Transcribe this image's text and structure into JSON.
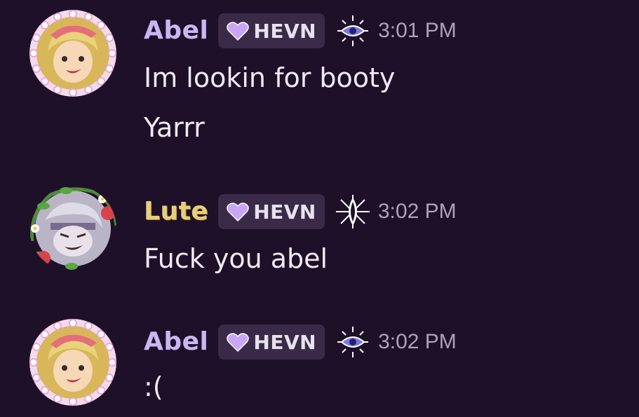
{
  "messages": [
    {
      "author": "Abel",
      "tag": "HEVN",
      "badge_icon": "eye-sun-icon",
      "time": "3:01 PM",
      "lines": [
        "Im lookin for booty",
        "Yarrr"
      ]
    },
    {
      "author": "Lute",
      "tag": "HEVN",
      "badge_icon": "slit-eye-star-icon",
      "time": "3:02 PM",
      "lines": [
        "Fuck you abel"
      ]
    },
    {
      "author": "Abel",
      "tag": "HEVN",
      "badge_icon": "eye-sun-icon",
      "time": "3:02 PM",
      "lines": [
        ":("
      ]
    }
  ],
  "colors": {
    "background": "#1f1029",
    "abel_name": "#c8b7f2",
    "lute_name": "#e6cf7c",
    "tag_bg": "#3a2a48",
    "heart": "#c9a6f5"
  }
}
